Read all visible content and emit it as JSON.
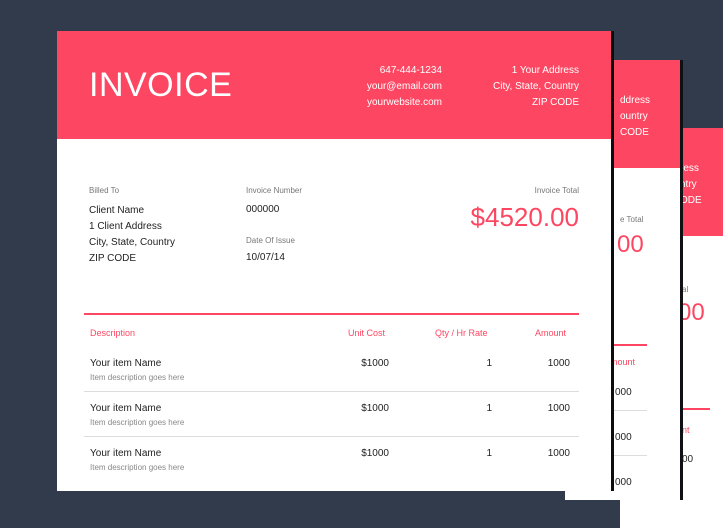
{
  "invoice": {
    "title": "INVOICE",
    "phone": "647-444-1234",
    "email": "your@email.com",
    "website": "yourwebsite.com",
    "address_line1": "1 Your Address",
    "address_line2": "City, State, Country",
    "address_line3": "ZIP CODE",
    "billed_to_label": "Billed To",
    "client_name": "Client Name",
    "client_address": "1 Client Address",
    "client_city": "City, State, Country",
    "client_zip": "ZIP CODE",
    "invoice_number_label": "Invoice Number",
    "invoice_number": "000000",
    "date_label": "Date Of Issue",
    "date": "10/07/14",
    "total_label": "Invoice Total",
    "total": "$4520.00",
    "columns": {
      "description": "Description",
      "unit_cost": "Unit Cost",
      "qty": "Qty / Hr Rate",
      "amount": "Amount"
    },
    "items": [
      {
        "name": "Your item Name",
        "description": "Item description goes here",
        "unit_cost": "$1000",
        "qty": "1",
        "amount": "1000"
      },
      {
        "name": "Your item Name",
        "description": "Item description goes here",
        "unit_cost": "$1000",
        "qty": "1",
        "amount": "1000"
      },
      {
        "name": "Your item Name",
        "description": "Item description goes here",
        "unit_cost": "$1000",
        "qty": "1",
        "amount": "1000"
      }
    ]
  },
  "back_page_1": {
    "addr_fragment": "ddress",
    "country_fragment": "ountry",
    "zip_fragment": "CODE",
    "total_label_fragment": "e Total",
    "total_fragment": "00",
    "amount_fragment": "mount",
    "row_values": [
      "000",
      "000",
      "000"
    ]
  },
  "back_page_2": {
    "addr_fragment": "ress",
    "country_fragment": "ntry",
    "zip_fragment": "ODE",
    "total_label_fragment": "al",
    "total_fragment": "00",
    "amount_fragment": "unt",
    "row_values": [
      "00"
    ]
  },
  "colors": {
    "background": "#323b4c",
    "accent": "#fd4762",
    "paper": "#ffffff"
  }
}
